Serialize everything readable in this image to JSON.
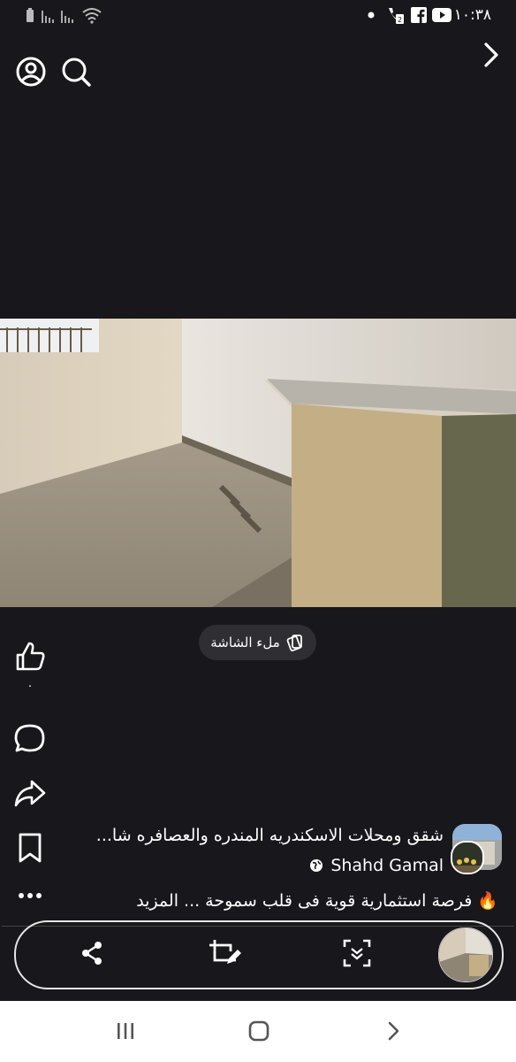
{
  "status_bar": {
    "time": "١٠:٣٨",
    "icons": [
      "battery-icon",
      "signal-icon",
      "signal-icon",
      "wifi-icon",
      "dot-icon",
      "call-icon",
      "facebook-icon",
      "youtube-icon"
    ]
  },
  "top": {
    "icons": [
      "profile-icon",
      "search-icon",
      "chevron-right-icon"
    ]
  },
  "video": {
    "fill_screen_label": "ملء الشاشة"
  },
  "actions": {
    "like_count": "٠",
    "icons": [
      "like-icon",
      "comment-icon",
      "share-icon",
      "bookmark-icon",
      "more-icon"
    ]
  },
  "post": {
    "caption": "شقق ومحلات الاسكندريه المندره والعصافره شا...",
    "author": "Shahd Gamal",
    "description": "فرصة استثمارية قوية فى قلب سموحة ... المزيد",
    "description_emoji": "🔥"
  },
  "bottom_bar": {
    "icons": [
      "share-node-icon",
      "edit-crop-icon",
      "scan-icon",
      "video-thumbnail"
    ]
  },
  "nav_bar": {
    "icons": [
      "recent-apps-icon",
      "home-icon",
      "back-icon"
    ]
  },
  "colors": {
    "background": "#18171c",
    "pill": "#2e2e33",
    "nav": "#ffffff"
  }
}
